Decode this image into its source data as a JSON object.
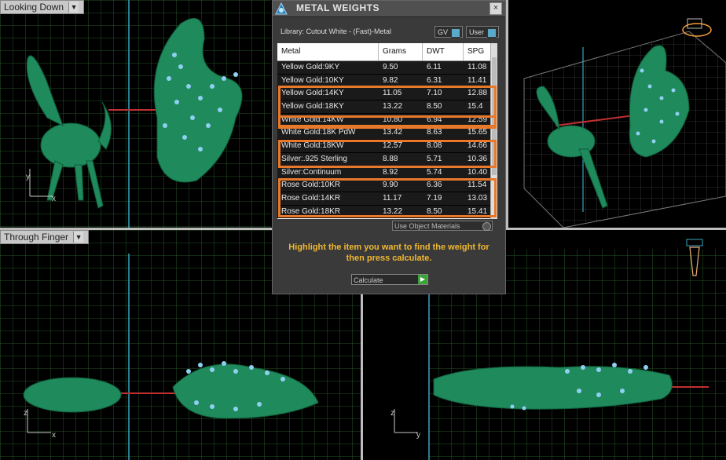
{
  "viewports": {
    "top_left_label": "Looking Down",
    "bottom_left_label": "Through Finger"
  },
  "panel": {
    "title": "METAL WEIGHTS",
    "close_glyph": "×",
    "library": "Library: Cutout White - (Fast)-Metal",
    "gv_label": "GV",
    "user_label": "User",
    "columns": [
      "Metal",
      "Grams",
      "DWT",
      "SPG"
    ],
    "rows": [
      {
        "metal": "Yellow Gold:9KY",
        "grams": "9.50",
        "dwt": "6.11",
        "spg": "11.08"
      },
      {
        "metal": "Yellow Gold:10KY",
        "grams": "9.82",
        "dwt": "6.31",
        "spg": "11.41"
      },
      {
        "metal": "Yellow Gold:14KY",
        "grams": "11.05",
        "dwt": "7.10",
        "spg": "12.88"
      },
      {
        "metal": "Yellow Gold:18KY",
        "grams": "13.22",
        "dwt": "8.50",
        "spg": "15.4"
      },
      {
        "metal": "White Gold:14KW",
        "grams": "10.80",
        "dwt": "6.94",
        "spg": "12.59"
      },
      {
        "metal": "White Gold:18K PdW",
        "grams": "13.42",
        "dwt": "8.63",
        "spg": "15.65"
      },
      {
        "metal": "White Gold:18KW",
        "grams": "12.57",
        "dwt": "8.08",
        "spg": "14.66"
      },
      {
        "metal": "Silver:.925 Sterling",
        "grams": "8.88",
        "dwt": "5.71",
        "spg": "10.36"
      },
      {
        "metal": "Silver:Continuum",
        "grams": "8.92",
        "dwt": "5.74",
        "spg": "10.40"
      },
      {
        "metal": "Rose Gold:10KR",
        "grams": "9.90",
        "dwt": "6.36",
        "spg": "11.54"
      },
      {
        "metal": "Rose Gold:14KR",
        "grams": "11.17",
        "dwt": "7.19",
        "spg": "13.03"
      },
      {
        "metal": "Rose Gold:18KR",
        "grams": "13.22",
        "dwt": "8.50",
        "spg": "15.41"
      }
    ],
    "use_object_materials": "Use Object Materials",
    "hint": "Highlight the item you want to find the weight for then press calculate.",
    "calculate_label": "Calculate",
    "highlight_color": "#e8782a",
    "hint_color": "#f0b832"
  },
  "axes": {
    "x": "x",
    "y": "y",
    "z": "z"
  }
}
